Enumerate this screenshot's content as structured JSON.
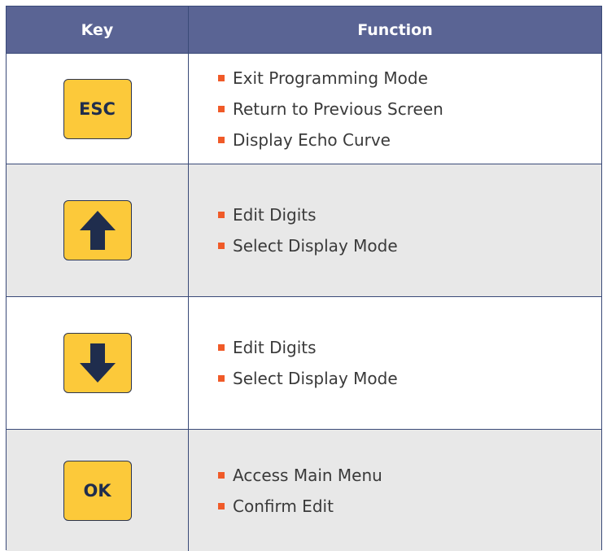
{
  "header": {
    "key_label": "Key",
    "function_label": "Function"
  },
  "rows": [
    {
      "key": {
        "type": "text",
        "label": "ESC"
      },
      "functions": [
        "Exit Programming Mode",
        "Return to Previous Screen",
        "Display Echo Curve"
      ]
    },
    {
      "key": {
        "type": "icon",
        "icon": "arrow-up-icon"
      },
      "functions": [
        "Edit Digits",
        "Select Display Mode"
      ]
    },
    {
      "key": {
        "type": "icon",
        "icon": "arrow-down-icon"
      },
      "functions": [
        "Edit Digits",
        "Select Display Mode"
      ]
    },
    {
      "key": {
        "type": "text",
        "label": "OK"
      },
      "functions": [
        "Access Main Menu",
        "Confirm Edit"
      ]
    }
  ],
  "colors": {
    "header_bg": "#5a6494",
    "keycap_bg": "#fcc93a",
    "keycap_glyph": "#1f2d4d",
    "bullet": "#f05a28",
    "alt_row_bg": "#e8e8e8"
  }
}
